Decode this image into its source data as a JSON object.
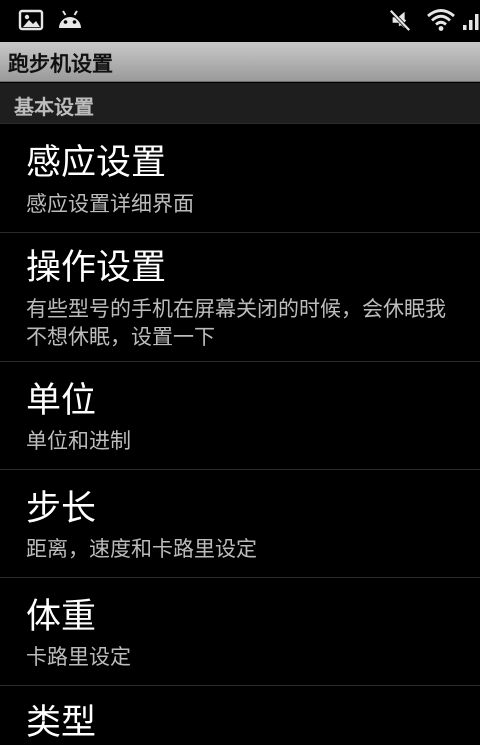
{
  "status_bar": {
    "icons": [
      "picture-icon",
      "android-icon",
      "mute-icon",
      "wifi-icon",
      "signal-icon"
    ]
  },
  "title_bar": {
    "title": "跑步机设置"
  },
  "section": {
    "label": "基本设置"
  },
  "preferences": [
    {
      "title": "感应设置",
      "summary": "感应设置详细界面"
    },
    {
      "title": "操作设置",
      "summary": "有些型号的手机在屏幕关闭的时候，会休眠我\n不想休眠，设置一下"
    },
    {
      "title": "单位",
      "summary": "单位和进制"
    },
    {
      "title": "步长",
      "summary": "距离，速度和卡路里设定"
    },
    {
      "title": "体重",
      "summary": "卡路里设定"
    },
    {
      "title": "类型",
      "summary": ""
    }
  ],
  "colors": {
    "background": "#000000",
    "title_bar": "#b0b0b0",
    "section_header": "#1e1e1e",
    "summary_text": "#bcbcbc"
  }
}
